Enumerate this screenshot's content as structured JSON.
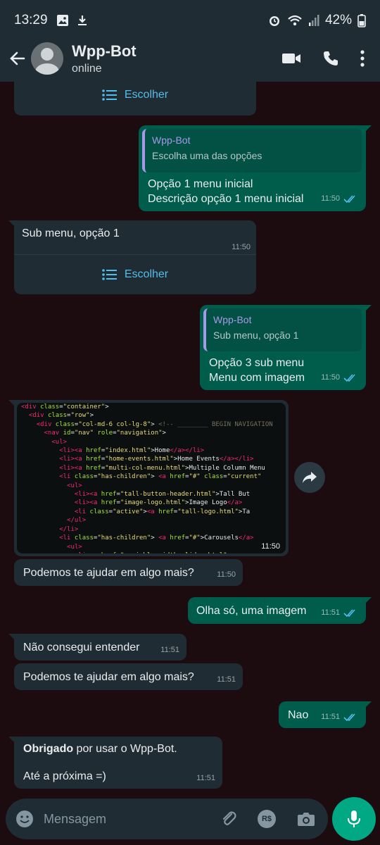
{
  "status": {
    "time": "13:29",
    "battery": "42%"
  },
  "header": {
    "title": "Wpp-Bot",
    "subtitle": "online"
  },
  "choose_label": "Escolher",
  "messages": {
    "m1": {
      "quote_title": "Wpp-Bot",
      "quote_sub": "Escolha uma das opções",
      "line1": "Opção 1 menu inicial",
      "line2": "Descrição opção 1 menu inicial",
      "time": "11:50"
    },
    "m2": {
      "text": "Sub menu, opção 1",
      "time": "11:50"
    },
    "m3": {
      "quote_title": "Wpp-Bot",
      "quote_sub": "Sub menu, opção 1",
      "line1": "Opção 3 sub menu",
      "line2": "Menu com imagem",
      "time": "11:50"
    },
    "m4": {
      "time": "11:50"
    },
    "m5": {
      "text": "Podemos te ajudar em algo mais?",
      "time": "11:50"
    },
    "m6": {
      "text": "Olha só, uma imagem",
      "time": "11:51"
    },
    "m7": {
      "text": "Não consegui entender",
      "time": "11:51"
    },
    "m8": {
      "text": "Podemos te ajudar em algo mais?",
      "time": "11:51"
    },
    "m9": {
      "text": "Nao",
      "time": "11:51"
    },
    "m10": {
      "bold": "Obrigado",
      "rest": " por usar o Wpp-Bot.",
      "line2": "Até a próxima =)",
      "time": "11:51"
    }
  },
  "input": {
    "placeholder": "Mensagem",
    "currency_icon_label": "R$"
  },
  "colors": {
    "accent": "#00a884",
    "link": "#53bdeb",
    "quote_name": "#a899e8"
  }
}
